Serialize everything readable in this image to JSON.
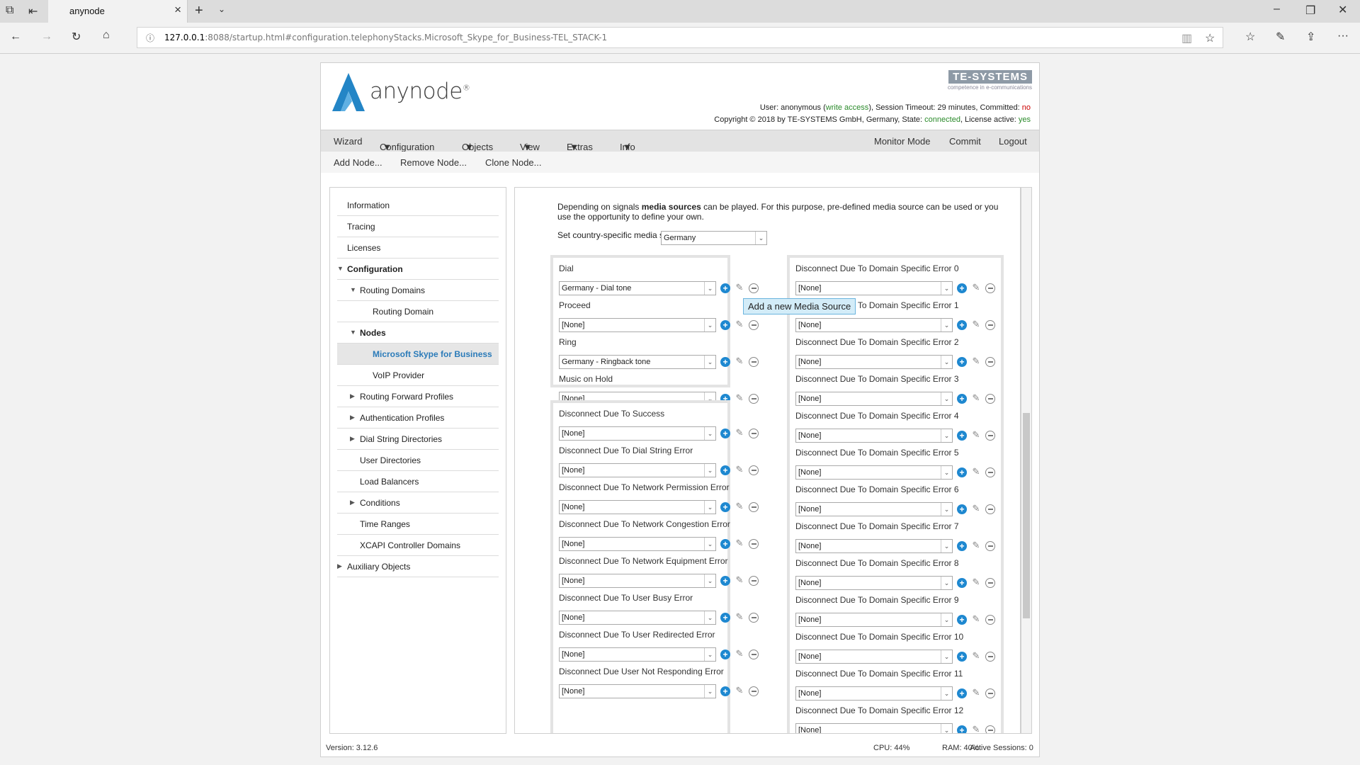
{
  "browser": {
    "tab_title": "anynode",
    "url_prefix": "127.0.0.1",
    "url_rest": ":8088/startup.html#configuration.telephonyStacks.Microsoft_Skype_for_Business-TEL_STACK-1"
  },
  "header": {
    "logo": "anynode",
    "logo_mark": "®",
    "te_logo": "TE-SYSTEMS",
    "te_tagline": "competence in e-communications",
    "user_prefix": "User: anonymous (",
    "write_access": "write access",
    "user_mid": "), Session Timeout: 29 minutes, Committed:",
    "committed": "no",
    "copyright": "Copyright © 2018 by TE-SYSTEMS GmbH, Germany, State:",
    "state": "connected",
    "license_lbl": ", License active:",
    "license": "yes"
  },
  "mainnav": {
    "wizard": "Wizard",
    "configuration": "Configuration",
    "objects": "Objects",
    "view": "View",
    "extras": "Extras",
    "info": "Info",
    "monitor": "Monitor Mode",
    "commit": "Commit",
    "logout": "Logout"
  },
  "subnav": {
    "add": "Add Node...",
    "remove": "Remove Node...",
    "clone": "Clone Node..."
  },
  "tree": [
    {
      "label": "Information"
    },
    {
      "label": "Tracing"
    },
    {
      "label": "Licenses"
    },
    {
      "label": "Configuration"
    },
    {
      "label": "Routing Domains"
    },
    {
      "label": "Routing Domain"
    },
    {
      "label": "Nodes"
    },
    {
      "label": "Microsoft Skype for Business"
    },
    {
      "label": "VoIP Provider"
    },
    {
      "label": "Routing Forward Profiles"
    },
    {
      "label": "Authentication Profiles"
    },
    {
      "label": "Dial String Directories"
    },
    {
      "label": "User Directories"
    },
    {
      "label": "Load Balancers"
    },
    {
      "label": "Conditions"
    },
    {
      "label": "Time Ranges"
    },
    {
      "label": "XCAPI Controller Domains"
    },
    {
      "label": "Auxiliary Objects"
    }
  ],
  "content": {
    "intro_1": "Depending on signals ",
    "intro_bold": "media sources",
    "intro_2": " can be played. For this purpose, pre-defined media source can be used or you use the opportunity to define your own.",
    "country_label": "Set country-specific media sources",
    "country_value": "Germany",
    "group1": [
      {
        "label": "Dial",
        "value": "Germany - Dial tone"
      },
      {
        "label": "Proceed",
        "value": "[None]"
      },
      {
        "label": "Ring",
        "value": "Germany - Ringback tone"
      },
      {
        "label": "Music on Hold",
        "value": "[None]"
      }
    ],
    "group2": [
      {
        "label": "Disconnect Due To Success",
        "value": "[None]"
      },
      {
        "label": "Disconnect Due To Dial String Error",
        "value": "[None]"
      },
      {
        "label": "Disconnect Due To Network Permission Error",
        "value": "[None]"
      },
      {
        "label": "Disconnect Due To Network Congestion Error",
        "value": "[None]"
      },
      {
        "label": "Disconnect Due To Network Equipment Error",
        "value": "[None]"
      },
      {
        "label": "Disconnect Due To User Busy Error",
        "value": "[None]"
      },
      {
        "label": "Disconnect Due To User Redirected Error",
        "value": "[None]"
      },
      {
        "label": "Disconnect Due User Not Responding Error",
        "value": "[None]"
      }
    ],
    "group3": [
      {
        "label": "Disconnect Due To Domain Specific Error 0",
        "value": "[None]"
      },
      {
        "label": "Disconnect Due To Domain Specific Error 1",
        "value": "[None]"
      },
      {
        "label": "Disconnect Due To Domain Specific Error 2",
        "value": "[None]"
      },
      {
        "label": "Disconnect Due To Domain Specific Error 3",
        "value": "[None]"
      },
      {
        "label": "Disconnect Due To Domain Specific Error 4",
        "value": "[None]"
      },
      {
        "label": "Disconnect Due To Domain Specific Error 5",
        "value": "[None]"
      },
      {
        "label": "Disconnect Due To Domain Specific Error 6",
        "value": "[None]"
      },
      {
        "label": "Disconnect Due To Domain Specific Error 7",
        "value": "[None]"
      },
      {
        "label": "Disconnect Due To Domain Specific Error 8",
        "value": "[None]"
      },
      {
        "label": "Disconnect Due To Domain Specific Error 9",
        "value": "[None]"
      },
      {
        "label": "Disconnect Due To Domain Specific Error 10",
        "value": "[None]"
      },
      {
        "label": "Disconnect Due To Domain Specific Error 11",
        "value": "[None]"
      },
      {
        "label": "Disconnect Due To Domain Specific Error 12",
        "value": "[None]"
      }
    ],
    "tooltip": "Add a new Media Source"
  },
  "footer": {
    "version": "Version: 3.12.6",
    "cpu": "CPU: 44%",
    "ram": "RAM: 40%",
    "sessions": "Active Sessions: 0"
  }
}
